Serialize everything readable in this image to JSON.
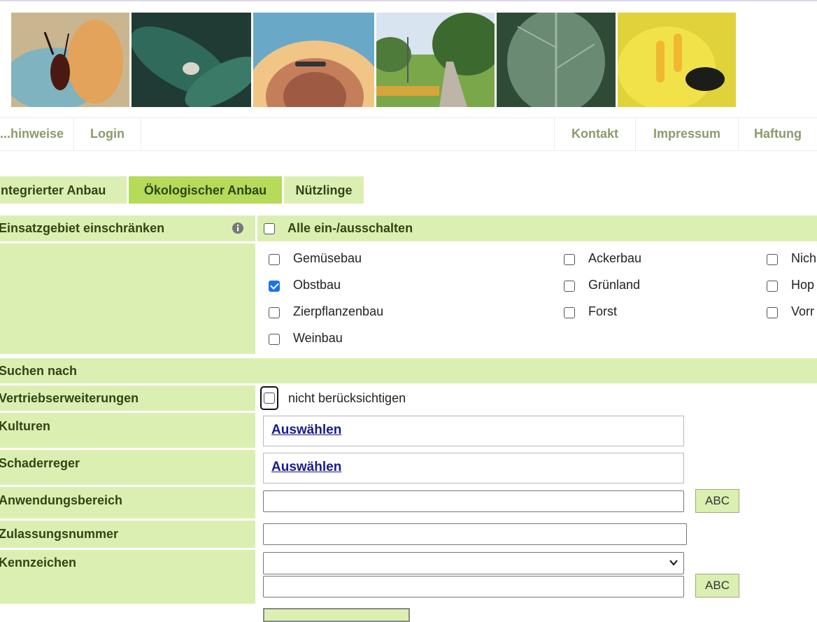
{
  "nav": {
    "left": [
      "...hinweise",
      "Login"
    ],
    "right": [
      "Kontakt",
      "Impressum",
      "Haftung"
    ]
  },
  "tabs": [
    "Integrierter Anbau",
    "Ökologischer Anbau",
    "Nützlinge"
  ],
  "active_tab": "Ökologischer Anbau",
  "einsatzgebiet": {
    "label": "Einsatzgebiet einschränken",
    "toggle_all": "Alle ein-/ausschalten",
    "options": [
      {
        "label": "Gemüsebau",
        "checked": false
      },
      {
        "label": "Obstbau",
        "checked": true
      },
      {
        "label": "Zierpflanzenbau",
        "checked": false
      },
      {
        "label": "Weinbau",
        "checked": false
      },
      {
        "label": "Ackerbau",
        "checked": false
      },
      {
        "label": "Grünland",
        "checked": false
      },
      {
        "label": "Forst",
        "checked": false
      },
      {
        "label": "Nich",
        "checked": false
      },
      {
        "label": "Hop",
        "checked": false
      },
      {
        "label": "Vorr",
        "checked": false
      }
    ]
  },
  "search": {
    "header": "Suchen nach",
    "vertrieb_label": "Vertriebserweiterungen",
    "vertrieb_option": "nicht berücksichtigen",
    "kulturen_label": "Kulturen",
    "kulturen_link": "Auswählen",
    "schaderreger_label": "Schaderreger",
    "schaderreger_link": "Auswählen",
    "anwendungsbereich_label": "Anwendungsbereich",
    "zulassungsnummer_label": "Zulassungsnummer",
    "kennzeichen_label": "Kennzeichen",
    "abc_button": "ABC"
  },
  "colors": {
    "label_bg": "#dcefb2",
    "active_tab_bg": "#b6da5a",
    "nav_text": "#8c9a6e",
    "link": "#1a1a8c"
  }
}
